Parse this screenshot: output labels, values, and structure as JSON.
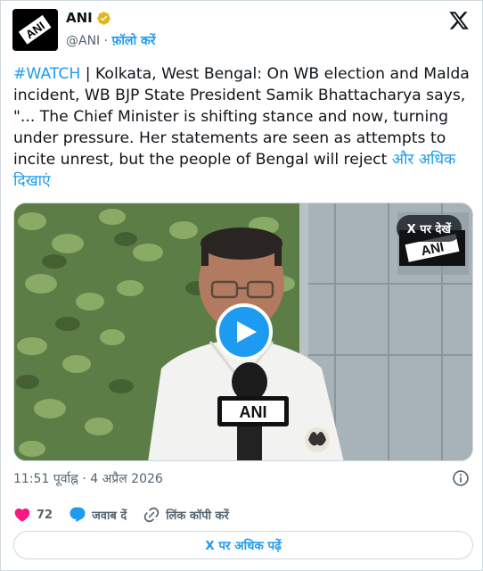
{
  "author": {
    "name": "ANI",
    "handle": "@ANI",
    "separator": "·",
    "follow_label": "फ़ॉलो करें",
    "avatar_text": "ANI"
  },
  "tweet": {
    "hashtag": "#WATCH",
    "body": " | Kolkata, West Bengal: On WB election and Malda incident, WB BJP State President Samik Bhattacharya says, \"... The Chief Minister is shifting stance and now, turning under pressure. Her statements are seen as attempts to incite unrest, but the people of Bengal will reject ",
    "show_more": "और अधिक दिखाएं"
  },
  "video": {
    "watch_on_x": "X पर देखें",
    "watermark": "ANI",
    "mic_label": "ANI"
  },
  "meta": {
    "timestamp": "11:51 पूर्वाह्न · 4 अप्रैल 2026"
  },
  "actions": {
    "likes": "72",
    "reply_label": "जवाब दें",
    "copy_link_label": "लिंक कॉपी करें"
  },
  "footer": {
    "read_more_label": "X पर अधिक पढ़ें"
  },
  "colors": {
    "accent": "#1d9bf0",
    "like": "#f91880",
    "muted": "#536471",
    "border": "#cfd9de"
  },
  "icons": [
    "verified-badge-icon",
    "x-logo-icon",
    "play-icon",
    "info-icon",
    "heart-icon",
    "reply-bubble-icon",
    "link-icon"
  ]
}
